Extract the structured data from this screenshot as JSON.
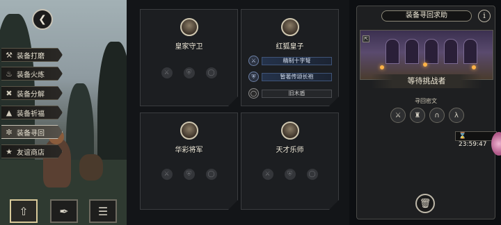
{
  "sidebar": {
    "back_icon": "chevron-left-icon",
    "items": [
      {
        "label": "装备打磨",
        "icon": "hammer-icon"
      },
      {
        "label": "装备火炼",
        "icon": "flame-icon"
      },
      {
        "label": "装备分解",
        "icon": "break-icon"
      },
      {
        "label": "装备祈福",
        "icon": "pray-icon"
      },
      {
        "label": "装备寻回",
        "icon": "spiral-icon",
        "active": true
      },
      {
        "label": "友谊商店",
        "icon": "fox-icon"
      }
    ],
    "bottom_buttons": [
      {
        "icon": "upload-icon",
        "active": true
      },
      {
        "icon": "feather-icon"
      },
      {
        "icon": "list-icon"
      }
    ]
  },
  "heroes": [
    {
      "name": "皇家守卫",
      "equipment": []
    },
    {
      "name": "红狐皇子",
      "equipment": [
        {
          "name": "精制十字弩",
          "rarity": "blue"
        },
        {
          "name": "暂著传颂长袍",
          "rarity": "blue"
        },
        {
          "name": "旧木盾",
          "rarity": "grey"
        }
      ]
    },
    {
      "name": "华彩将军",
      "equipment": []
    },
    {
      "name": "天才乐师",
      "equipment": []
    }
  ],
  "panel": {
    "title": "装备寻回求助",
    "info_label": "i",
    "status": "等待挑战者",
    "secret_label": "寻回密文",
    "timer": "23:59:47"
  },
  "colors": {
    "accent": "#d9c99a",
    "blue_item": "#3f5478"
  }
}
